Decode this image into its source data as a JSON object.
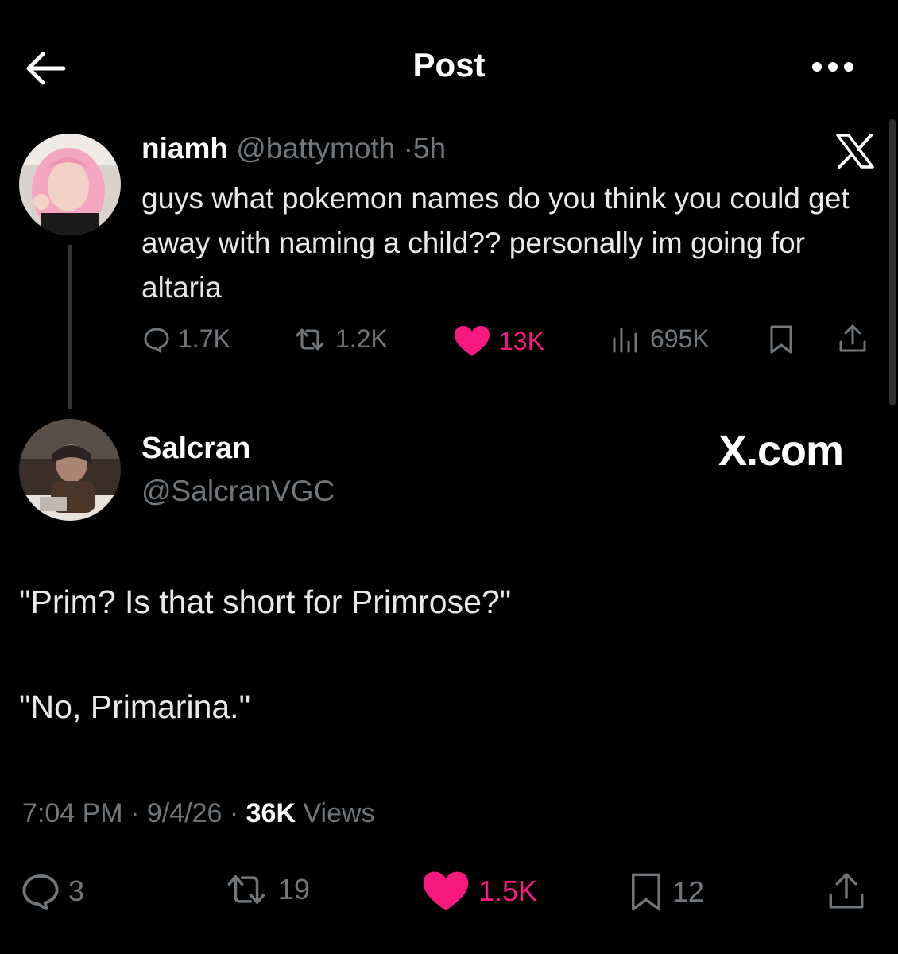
{
  "header": {
    "title": "Post",
    "back_icon": "arrow-left-icon",
    "more_icon": "more-horizontal-icon"
  },
  "quoted_post": {
    "author_name": "niamh",
    "author_handle": "@battymoth",
    "separator": "·",
    "time_ago": "5h",
    "text": "guys what pokemon names do you think you could get away with naming a child?? personally im going for altaria",
    "stats": {
      "replies": "1.7K",
      "reposts": "1.2K",
      "likes": "13K",
      "views": "695K"
    },
    "watermark_icon": "x-logo-icon"
  },
  "main_post": {
    "author_name": "Salcran",
    "author_handle": "@SalcranVGC",
    "site_label": "X.com",
    "text_line_1": "\"Prim? Is that short for Primrose?\"",
    "text_line_2": "\"No, Primarina.\"",
    "time": "7:04 PM",
    "separator": "·",
    "date": "9/4/26",
    "views_count": "36K",
    "views_label": "Views",
    "stats": {
      "replies": "3",
      "reposts": "19",
      "likes": "1.5K",
      "bookmarks": "12"
    }
  },
  "colors": {
    "background": "#000000",
    "text": "#e7e9ea",
    "muted": "#71767b",
    "like": "#f91880"
  }
}
